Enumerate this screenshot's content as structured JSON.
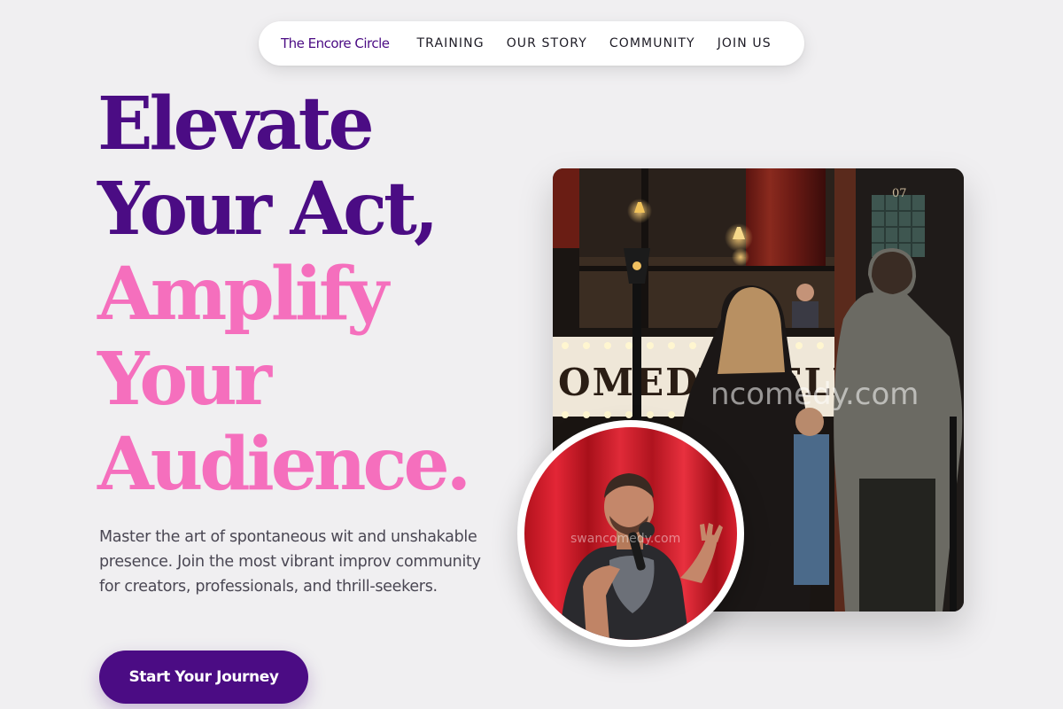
{
  "nav": {
    "brand": "The Encore Circle",
    "links": [
      "TRAINING",
      "OUR STORY",
      "COMMUNITY",
      "JOIN US"
    ]
  },
  "hero": {
    "headline_lines": [
      {
        "text": "Elevate",
        "tone": "purple"
      },
      {
        "text": "Your Act,",
        "tone": "purple"
      },
      {
        "text": "Amplify",
        "tone": "pink"
      },
      {
        "text": "Your",
        "tone": "pink"
      },
      {
        "text": "Audience.",
        "tone": "pink"
      }
    ],
    "description": "Master the art of spontaneous wit and unshakable presence. Join the most vibrant improv community for creators, professionals, and thrill-seekers.",
    "cta_label": "Start Your Journey"
  },
  "images": {
    "main_photo": {
      "marquee_text": "OMEDY CELLAR",
      "door_number": "07",
      "watermark": "ncomedy.com"
    },
    "circle_photo": {
      "watermark": "swancomedy.com"
    }
  },
  "colors": {
    "background": "#f0eff1",
    "brand_purple": "#4b0c84",
    "accent_pink": "#f56fbd",
    "body_text": "#4a4753",
    "curtain_red": "#d8202e"
  }
}
